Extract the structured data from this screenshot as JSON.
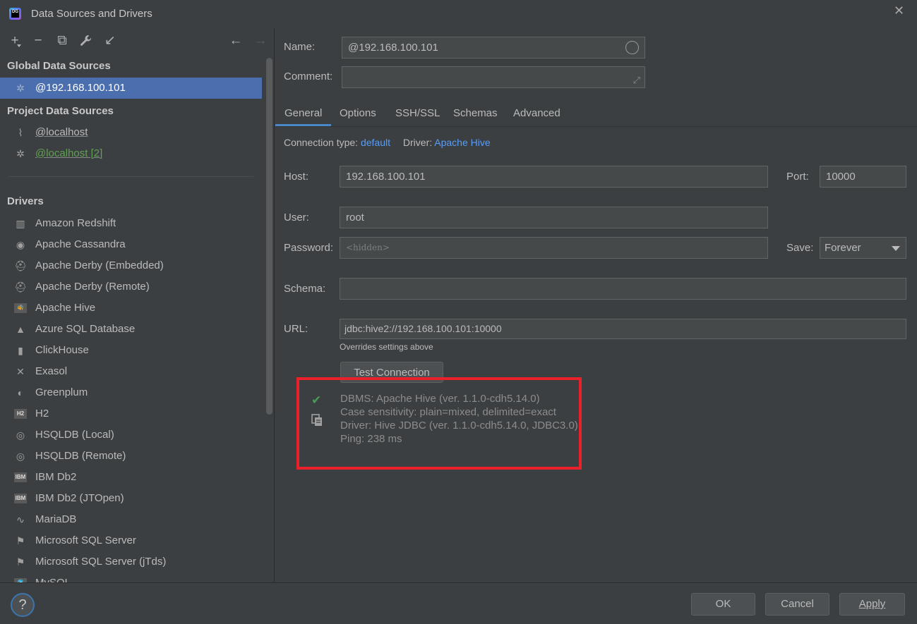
{
  "window": {
    "title": "Data Sources and Drivers"
  },
  "toolbar": {
    "add": "+",
    "remove": "−",
    "copy": "⧉",
    "wrench": "🔧",
    "import": "↙",
    "back": "←",
    "forward": "→"
  },
  "sidebar": {
    "global_heading": "Global Data Sources",
    "global_items": [
      {
        "label": "@192.168.100.101"
      }
    ],
    "project_heading": "Project Data Sources",
    "project_items": [
      {
        "label": "@localhost"
      },
      {
        "label": "@localhost [2]"
      }
    ],
    "drivers_heading": "Drivers",
    "drivers": [
      {
        "label": "Amazon Redshift",
        "glyph": "▥"
      },
      {
        "label": "Apache Cassandra",
        "glyph": "◉"
      },
      {
        "label": "Apache Derby (Embedded)",
        "glyph": "⛑"
      },
      {
        "label": "Apache Derby (Remote)",
        "glyph": "⛑"
      },
      {
        "label": "Apache Hive",
        "glyph": "🐝"
      },
      {
        "label": "Azure SQL Database",
        "glyph": "▲"
      },
      {
        "label": "ClickHouse",
        "glyph": "▮"
      },
      {
        "label": "Exasol",
        "glyph": "✕"
      },
      {
        "label": "Greenplum",
        "glyph": "◐"
      },
      {
        "label": "H2",
        "glyph": "H2"
      },
      {
        "label": "HSQLDB (Local)",
        "glyph": "◎"
      },
      {
        "label": "HSQLDB (Remote)",
        "glyph": "◎"
      },
      {
        "label": "IBM Db2",
        "glyph": "IBM"
      },
      {
        "label": "IBM Db2 (JTOpen)",
        "glyph": "IBM"
      },
      {
        "label": "MariaDB",
        "glyph": "∿"
      },
      {
        "label": "Microsoft SQL Server",
        "glyph": "⚑"
      },
      {
        "label": "Microsoft SQL Server (jTds)",
        "glyph": "⚑"
      },
      {
        "label": "MySQL",
        "glyph": "🐬"
      }
    ]
  },
  "form": {
    "name_label": "Name:",
    "name_value": "@192.168.100.101",
    "comment_label": "Comment:",
    "comment_value": "",
    "tabs": [
      "General",
      "Options",
      "SSH/SSL",
      "Schemas",
      "Advanced"
    ],
    "conn_type_label": "Connection type:",
    "conn_type_value": "default",
    "driver_label": "Driver:",
    "driver_value": "Apache Hive",
    "host_label": "Host:",
    "host_value": "192.168.100.101",
    "port_label": "Port:",
    "port_value": "10000",
    "user_label": "User:",
    "user_value": "root",
    "password_label": "Password:",
    "password_placeholder": "<hidden>",
    "save_label": "Save:",
    "save_value": "Forever",
    "schema_label": "Schema:",
    "schema_value": "",
    "url_label": "URL:",
    "url_value": "jdbc:hive2://192.168.100.101:10000",
    "url_note": "Overrides settings above",
    "test_button": "Test Connection"
  },
  "result": {
    "lines": [
      "DBMS: Apache Hive (ver. 1.1.0-cdh5.14.0)",
      "Case sensitivity: plain=mixed, delimited=exact",
      "Driver: Hive JDBC (ver. 1.1.0-cdh5.14.0, JDBC3.0)",
      "Ping: 238 ms"
    ],
    "highlight_color": "#e8212a",
    "success_color": "#499c54"
  },
  "footer": {
    "help": "?",
    "ok": "OK",
    "cancel": "Cancel",
    "apply": "Apply"
  }
}
